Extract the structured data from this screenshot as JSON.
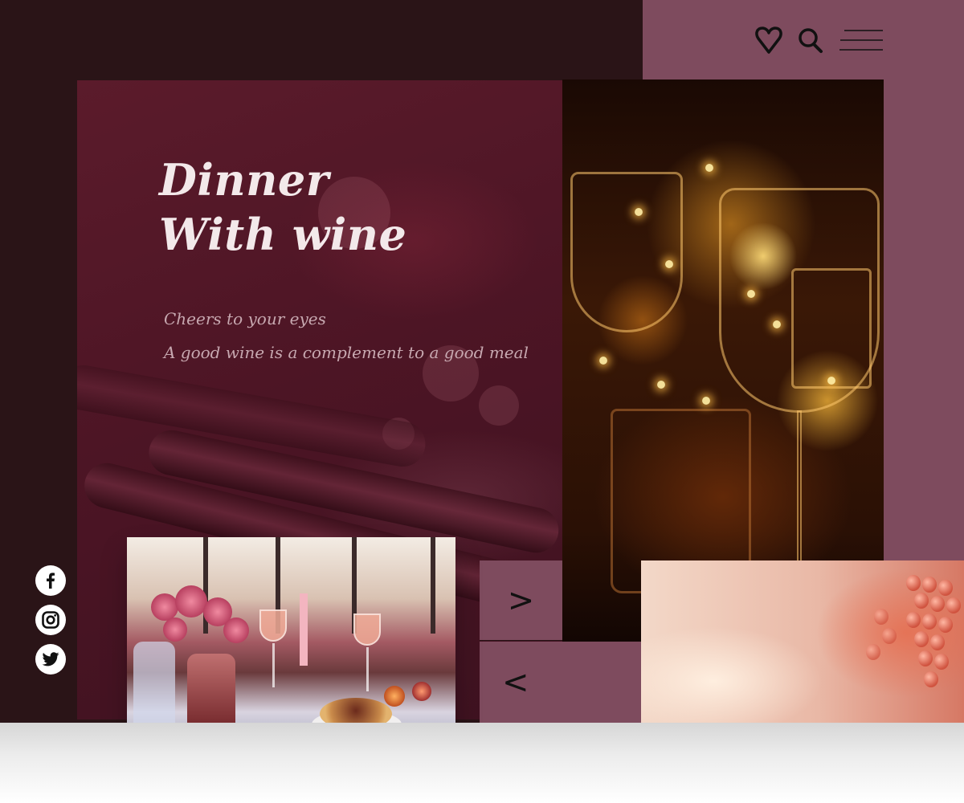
{
  "hero": {
    "title_line1": "Dinner",
    "title_line2": "With wine",
    "tagline_line1": "Cheers to your eyes",
    "tagline_line2": "A good wine is a complement to a good meal"
  },
  "header": {
    "icons": [
      "heart-icon",
      "search-icon",
      "menu-icon"
    ]
  },
  "nav": {
    "next": ">",
    "prev": "<"
  },
  "social": [
    "facebook-icon",
    "instagram-icon",
    "twitter-icon"
  ],
  "colors": {
    "dark_bg": "#2a1417",
    "mauve_bg": "#7e4b5e",
    "hero_bg": "#4d1525",
    "title_text": "#f3e9ea",
    "tagline_text": "#c7a8b0"
  }
}
